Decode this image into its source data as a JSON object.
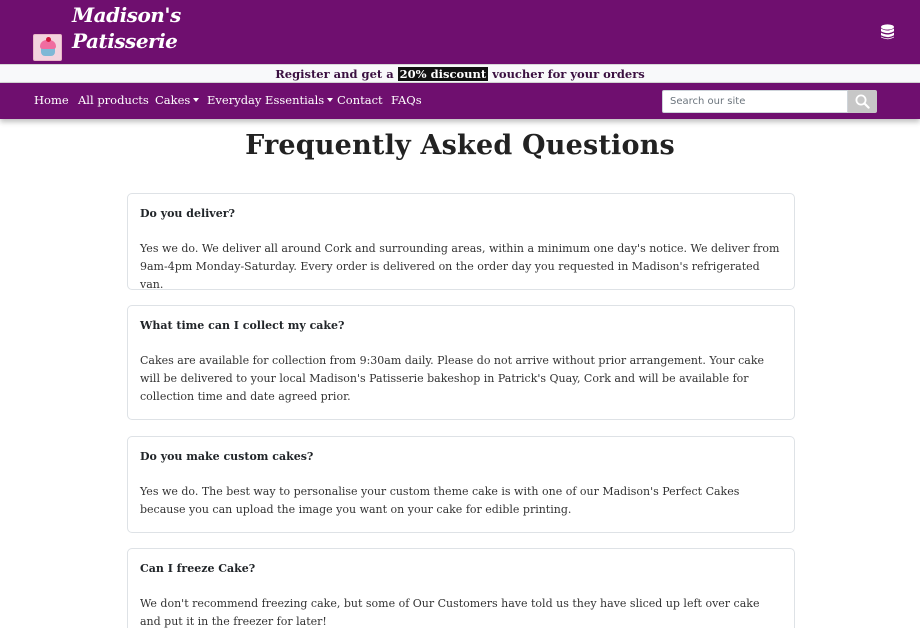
{
  "header": {
    "brand_line1": "Madison's",
    "brand_line2": "Patisserie",
    "logo_icon": "cupcake-logo",
    "db_icon": "database-icon"
  },
  "promo": {
    "before": "Register and get a",
    "highlight": "20% discount",
    "after": "voucher for your orders"
  },
  "nav": {
    "home": "Home",
    "all_products": "All products",
    "cakes": "Cakes",
    "everyday": "Everyday Essentials",
    "contact": "Contact",
    "faqs": "FAQs"
  },
  "search": {
    "placeholder": "Search our site",
    "icon": "search-icon"
  },
  "page": {
    "title": "Frequently Asked Questions"
  },
  "faqs": [
    {
      "question": "Do you deliver?",
      "answer": "Yes we do. We deliver all around Cork and surrounding areas, within a minimum one day's notice. We deliver from 9am-4pm Monday-Saturday. Every order is delivered on the order day you requested in Madison's refrigerated van."
    },
    {
      "question": "What time can I collect my cake?",
      "answer": "Cakes are available for collection from 9:30am daily. Please do not arrive without prior arrangement. Your cake will be delivered to your local Madison's Patisserie bakeshop in Patrick's Quay, Cork and will be available for collection time and date agreed prior."
    },
    {
      "question": "Do you make custom cakes?",
      "answer": "Yes we do. The best way to personalise your custom theme cake is with one of our Madison's Perfect Cakes because you can upload the image you want on your cake for edible printing."
    },
    {
      "question": "Can I freeze Cake?",
      "answer": "We don't recommend freezing cake, but some of Our Customers have told us they have sliced up left over cake and put it in the freezer for later!"
    }
  ],
  "colors": {
    "brand_purple": "#6f0f6f",
    "promo_bg": "#f8f9fa",
    "highlight_bg": "#111111"
  }
}
